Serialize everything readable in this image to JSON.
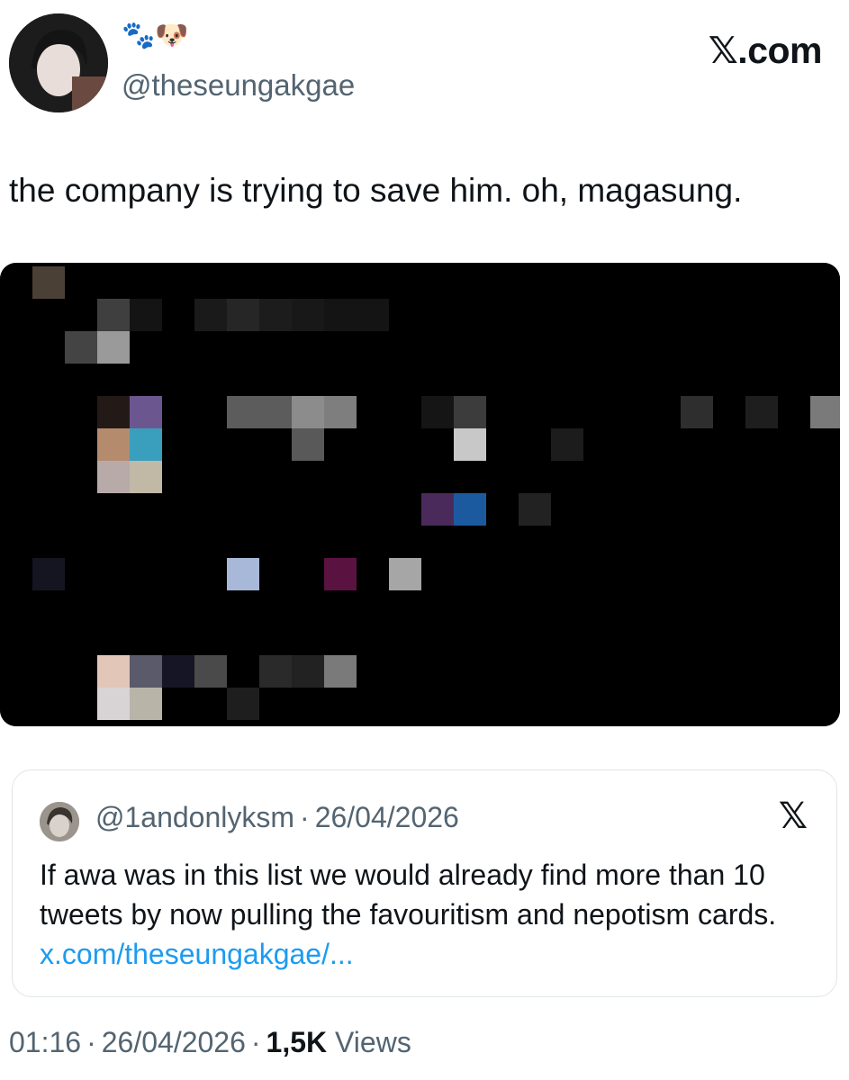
{
  "header": {
    "display_name": "🐾🐶",
    "handle": "@theseungakgae",
    "brand": "𝕏.com"
  },
  "tweet": {
    "text": "the company is trying to save him. oh, magasung."
  },
  "quote": {
    "handle": "@1andonlyksm",
    "separator": "·",
    "date": "26/04/2026",
    "x_logo": "𝕏",
    "text": "If awa was in this list we would already find more than 10 tweets by now pulling the favouritism and nepotism cards.",
    "link": "x.com/theseungakgae/..."
  },
  "footer": {
    "time": "01:16",
    "sep1": "·",
    "date": "26/04/2026",
    "sep2": "·",
    "views_count": "1,5K",
    "views_label": "Views"
  },
  "icons": {
    "media": "pixelated-image"
  }
}
